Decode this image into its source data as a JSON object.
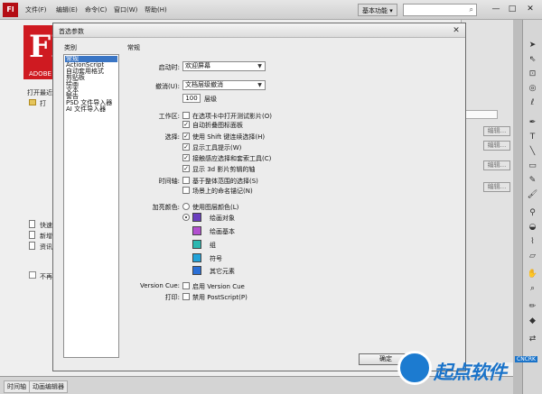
{
  "app": {
    "logo": "Fl",
    "menu": [
      "文件(F)",
      "编辑(E)",
      "命令(C)",
      "窗口(W)",
      "帮助(H)"
    ],
    "workspace": "基本功能 ▾",
    "window_controls": [
      "—",
      "□",
      "✕"
    ]
  },
  "welcome": {
    "brand": "FL",
    "brand_sub": "ADOBE",
    "open_recent": "打开最近",
    "open_item": "打",
    "bottom_items": [
      "快速",
      "新增",
      "资讯"
    ],
    "dont_show": "不再"
  },
  "timeline": {
    "tabs": [
      "时间轴",
      "动画编辑器"
    ]
  },
  "right_panel": {
    "edit_buttons": [
      "编辑...",
      "编辑...",
      "编辑...",
      "编辑..."
    ]
  },
  "dialog": {
    "title": "首选参数",
    "close": "✕",
    "category_header": "类别",
    "section_header": "常规",
    "categories": [
      "常规",
      "ActionScript",
      "自动套用格式",
      "剪贴板",
      "绘画",
      "文本",
      "警告",
      "PSD 文件导入器",
      "AI 文件导入器"
    ],
    "startup": {
      "label": "启动时:",
      "value": "欢迎屏幕"
    },
    "undo": {
      "label": "撤消(U):",
      "value": "文档层级撤消",
      "levels": "100",
      "levels_label": "层级"
    },
    "workspace": {
      "label": "工作区:",
      "options": [
        {
          "text": "在选项卡中打开测试影片(O)",
          "checked": false
        },
        {
          "text": "自动折叠图标面板",
          "checked": true
        }
      ]
    },
    "selection": {
      "label": "选择:",
      "options": [
        {
          "text": "使用 Shift 键连续选择(H)",
          "checked": true
        },
        {
          "text": "显示工具提示(W)",
          "checked": true
        },
        {
          "text": "接触感应选择和套索工具(C)",
          "checked": true
        },
        {
          "text": "显示 3d 影片剪辑的轴",
          "checked": true
        }
      ]
    },
    "timeline": {
      "label": "时间轴:",
      "options": [
        {
          "text": "基于整体范围的选择(S)",
          "checked": false
        },
        {
          "text": "场景上的命名锚记(N)",
          "checked": false
        }
      ]
    },
    "highlight": {
      "label": "加亮颜色:",
      "use_layer": "使用图层颜色(L)",
      "items": [
        {
          "text": "绘画对象",
          "color": "#6a3fbf"
        },
        {
          "text": "绘画基本",
          "color": "#b24fd0"
        },
        {
          "text": "组",
          "color": "#2bb7b0"
        },
        {
          "text": "符号",
          "color": "#22a3d9"
        },
        {
          "text": "其它元素",
          "color": "#2a6fd6"
        }
      ]
    },
    "version_cue": {
      "label": "Version Cue:",
      "text": "启用 Version Cue",
      "checked": false
    },
    "print": {
      "label": "打印:",
      "text": "禁用 PostScript(P)",
      "checked": false
    },
    "ok": "确定"
  },
  "watermark": {
    "text": "起点软件",
    "badge": "CNCRK"
  }
}
